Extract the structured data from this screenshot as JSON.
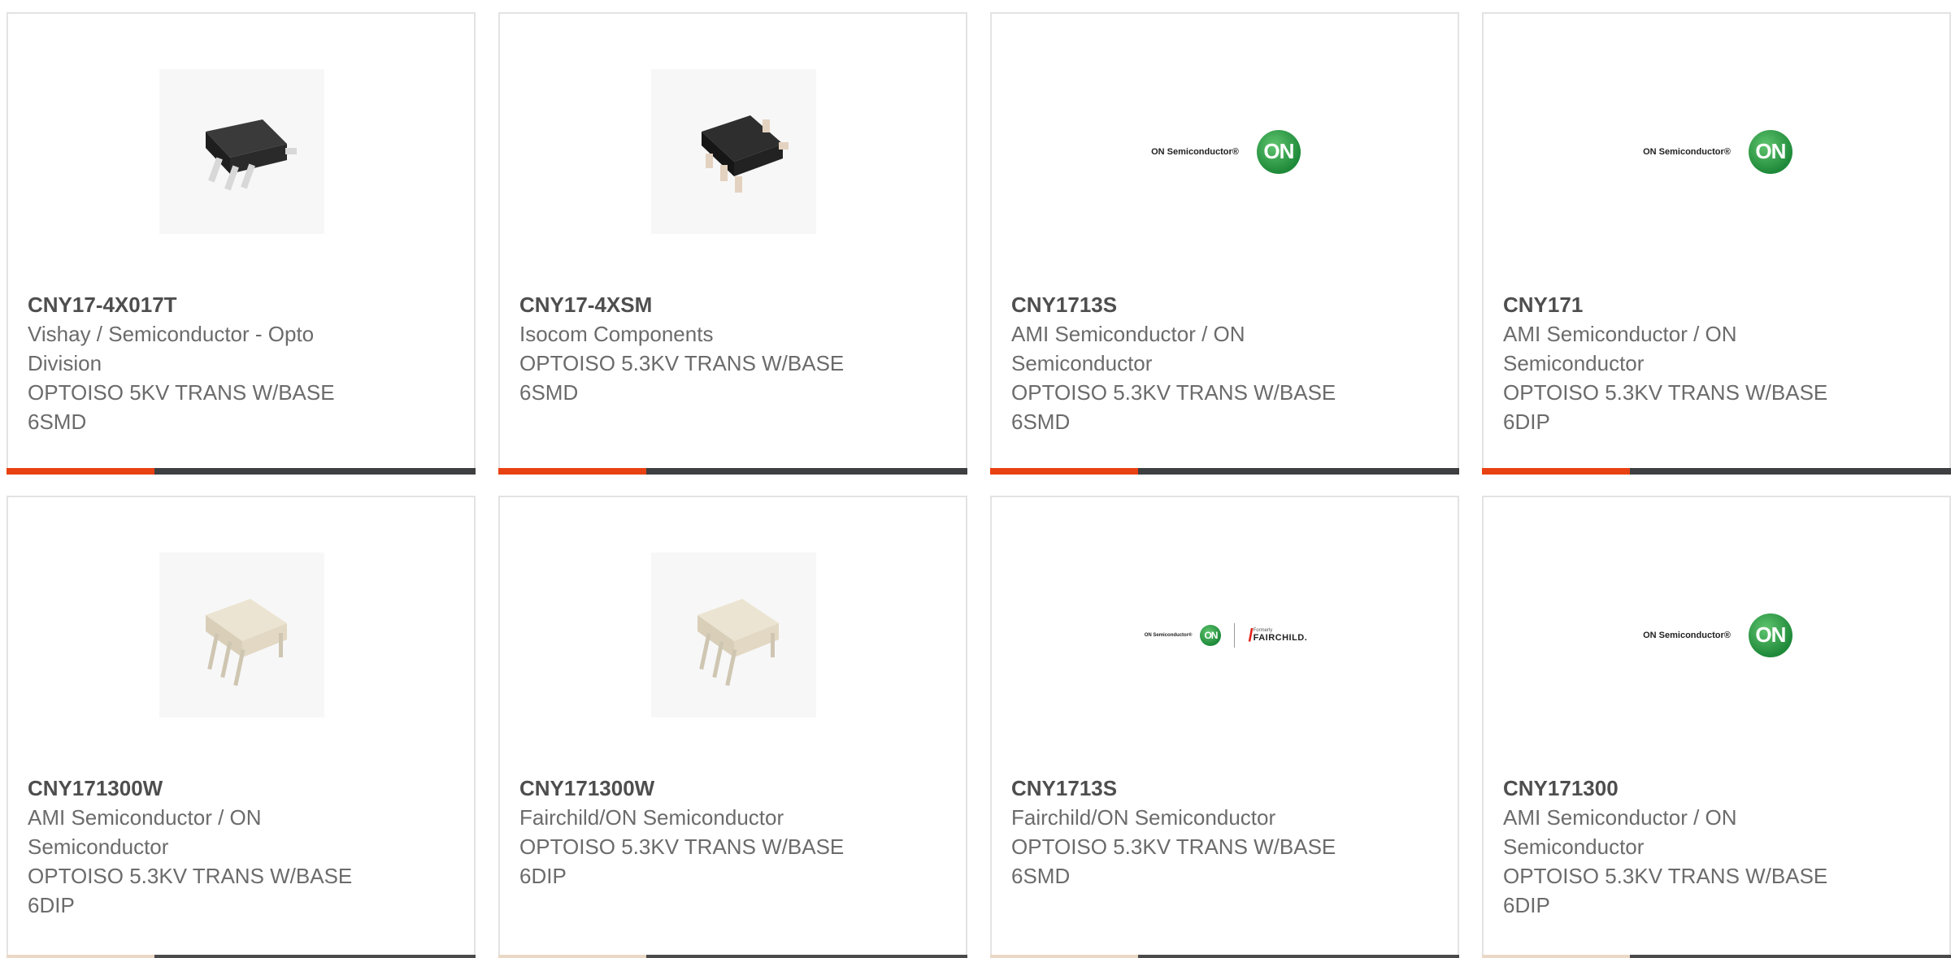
{
  "products": [
    {
      "part_number": "CNY17-4X017T",
      "manufacturer": "Vishay / Semiconductor - Opto Division",
      "description": "OPTOISO 5KV TRANS W/BASE 6SMD",
      "image": "black-smd-chip-photo"
    },
    {
      "part_number": "CNY17-4XSM",
      "manufacturer": "Isocom Components",
      "description": "OPTOISO 5.3KV TRANS W/BASE 6SMD",
      "image": "black-smd-chip-photo"
    },
    {
      "part_number": "CNY1713S",
      "manufacturer": "AMI Semiconductor / ON Semiconductor",
      "description": "OPTOISO 5.3KV TRANS W/BASE 6SMD",
      "image": "on-semiconductor-logo",
      "logo_text": "ON Semiconductor®",
      "logo_mark": "ON"
    },
    {
      "part_number": "CNY171",
      "manufacturer": "AMI Semiconductor / ON Semiconductor",
      "description": "OPTOISO 5.3KV TRANS W/BASE 6DIP",
      "image": "on-semiconductor-logo",
      "logo_text": "ON Semiconductor®",
      "logo_mark": "ON"
    },
    {
      "part_number": "CNY171300W",
      "manufacturer": "AMI Semiconductor / ON Semiconductor",
      "description": "OPTOISO 5.3KV TRANS W/BASE 6DIP",
      "image": "white-dip-chip-photo"
    },
    {
      "part_number": "CNY171300W",
      "manufacturer": "Fairchild/ON Semiconductor",
      "description": "OPTOISO 5.3KV TRANS W/BASE 6DIP",
      "image": "white-dip-chip-photo"
    },
    {
      "part_number": "CNY1713S",
      "manufacturer": "Fairchild/ON Semiconductor",
      "description": "OPTOISO 5.3KV TRANS W/BASE 6SMD",
      "image": "on-fairchild-logo",
      "logo_text": "ON Semiconductor®",
      "logo_mark": "ON",
      "logo_formerly": "Formerly",
      "logo_fairchild": "FAIRCHILD."
    },
    {
      "part_number": "CNY171300",
      "manufacturer": "AMI Semiconductor / ON Semiconductor",
      "description": "OPTOISO 5.3KV TRANS W/BASE 6DIP",
      "image": "on-semiconductor-logo",
      "logo_text": "ON Semiconductor®",
      "logo_mark": "ON"
    }
  ],
  "colors": {
    "accent": "#e84112",
    "bar_dark": "#3e3f41",
    "text": "#6b6b6b",
    "border": "#e3e3e3"
  }
}
